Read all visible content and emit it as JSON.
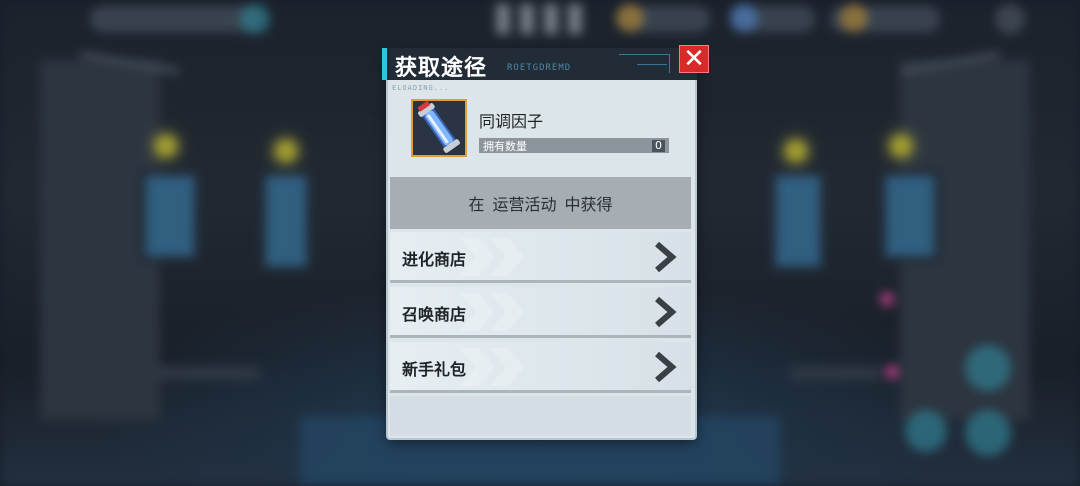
{
  "dialog": {
    "title": "获取途径",
    "title_deco": "ROETGDREMD",
    "loading_text": "ELOADING...",
    "close_label": "✕"
  },
  "item": {
    "icon": "capsule-icon",
    "name": "同调因子",
    "own_label": "拥有数量",
    "own_value": "0"
  },
  "source": {
    "prefix": "在",
    "activity": "运营活动",
    "suffix": "中获得"
  },
  "shops": [
    {
      "label": "进化商店"
    },
    {
      "label": "召唤商店"
    },
    {
      "label": "新手礼包"
    }
  ],
  "colors": {
    "accent": "#39c0e6",
    "close": "#d92a2a",
    "icon_frame": "#e39e2c"
  }
}
